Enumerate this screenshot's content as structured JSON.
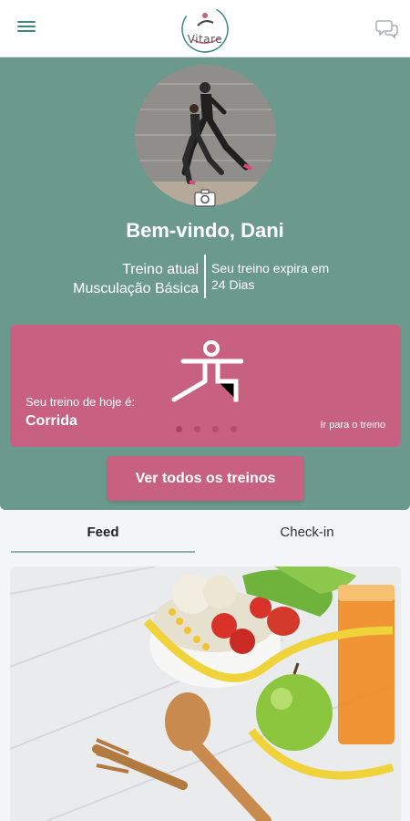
{
  "app": {
    "logo_text": "Vitare"
  },
  "header": {
    "menu_icon": "hamburger-icon",
    "chat_icon": "chat-bubbles-icon"
  },
  "profile": {
    "welcome": "Bem-vindo, Dani",
    "plan_label": "Treino atual",
    "plan_name": "Musculação Básica",
    "expires_label": "Seu treino expira em",
    "expires_value": "24 Dias",
    "camera_icon": "camera-icon"
  },
  "today_card": {
    "caption": "Seu treino de hoje é:",
    "workout": "Corrida",
    "link": "Ir para o treino",
    "icon": "workout-figure-icon",
    "dots_total": 4,
    "dots_active": 1
  },
  "all_workouts_label": "Ver todos os treinos",
  "tabs": [
    {
      "label": "Feed",
      "active": true
    },
    {
      "label": "Check-in",
      "active": false
    }
  ],
  "colors": {
    "primary_green": "#6b9a8c",
    "accent_pink": "#c86181",
    "icon_green": "#3d8a7c"
  }
}
